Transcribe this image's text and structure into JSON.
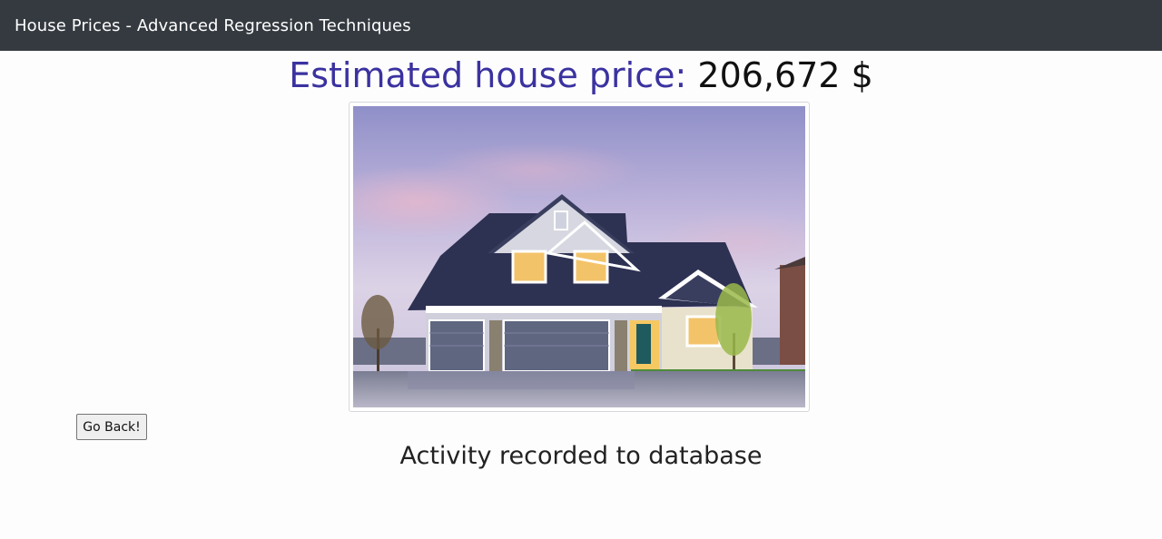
{
  "navbar": {
    "brand": "House Prices - Advanced Regression Techniques"
  },
  "result": {
    "label": "Estimated house price:",
    "value": "206,672 $"
  },
  "image": {
    "subject": "house-photo"
  },
  "actions": {
    "go_back": "Go Back!"
  },
  "status": {
    "message": "Activity recorded to database"
  },
  "colors": {
    "navbar_bg": "#343a40",
    "heading_accent": "#3b32a0",
    "page_bg": "#fdfdfd"
  }
}
